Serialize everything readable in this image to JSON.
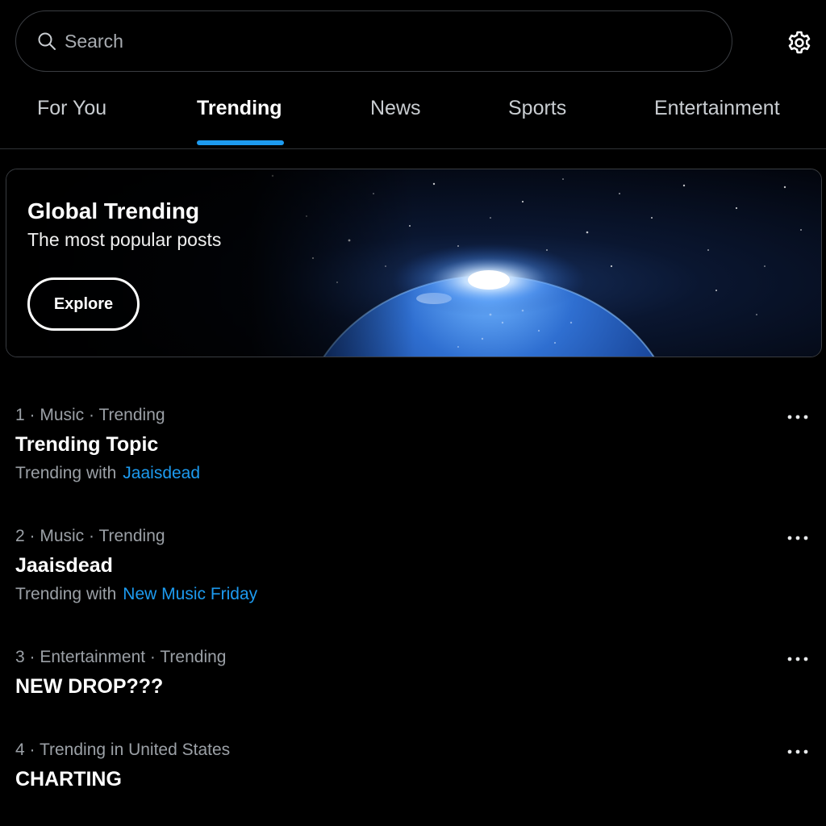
{
  "search": {
    "placeholder": "Search"
  },
  "tabs": [
    {
      "label": "For You"
    },
    {
      "label": "Trending"
    },
    {
      "label": "News"
    },
    {
      "label": "Sports"
    },
    {
      "label": "Entertainment"
    }
  ],
  "active_tab": "Trending",
  "banner": {
    "title": "Global Trending",
    "subtitle": "The most popular posts",
    "button_label": "Explore"
  },
  "trends": [
    {
      "meta": "1 · Music · Trending",
      "title": "Trending Topic",
      "with_prefix": "Trending with",
      "with_link": "Jaaisdead"
    },
    {
      "meta": "2 · Music · Trending",
      "title": "Jaaisdead",
      "with_prefix": "Trending with",
      "with_link": "New Music Friday"
    },
    {
      "meta": "3 · Entertainment · Trending",
      "title": "NEW DROP???"
    },
    {
      "meta": "4 · Trending in United States",
      "title": "CHARTING"
    }
  ],
  "icons": {
    "search": "search-icon",
    "settings": "gear-icon",
    "more": "more-icon"
  },
  "colors": {
    "background": "#000000",
    "accent": "#1d9bf0",
    "secondary_text": "#9ba0a6",
    "border": "#3a3d42"
  }
}
